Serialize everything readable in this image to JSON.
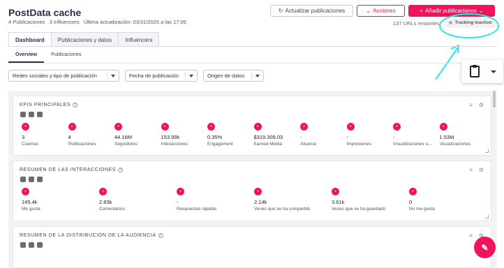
{
  "header": {
    "title": "PostData cache",
    "publications_count": "4 Publicaciones",
    "influencers_count": "3 Influencers",
    "last_update": "Última actualización: 03/31/2025 a las 17:05",
    "update_button": "Actualizar publicaciones",
    "actions_button": "Acciones",
    "add_button": "Añadir publicaciones",
    "urls_remaining": "137 URLs restantes",
    "tracking_status": "Tracking inactivo"
  },
  "tabs": [
    "Dashboard",
    "Publicaciones y datos",
    "Influencers"
  ],
  "subtabs": [
    "Overview",
    "Publicaciones"
  ],
  "filters": [
    "Redes sociales y tipo de publicación",
    "Fecha de publicación",
    "Origen de datos"
  ],
  "kpis_section": {
    "title": "KPIS PRINCIPALES",
    "items": [
      {
        "value": "3",
        "label": "Cuentas",
        "icon": "user-icon"
      },
      {
        "value": "4",
        "label": "Publicaciones",
        "icon": "post-icon"
      },
      {
        "value": "44.16M",
        "label": "Seguidores",
        "icon": "followers-icon"
      },
      {
        "value": "153.99k",
        "label": "Interacciones",
        "icon": "interaction-icon"
      },
      {
        "value": "0.35%",
        "label": "Engagement",
        "icon": "target-icon"
      },
      {
        "value": "$319.309.03",
        "label": "Earned Media",
        "icon": "dollar-icon"
      },
      {
        "value": "-",
        "label": "Alcance",
        "icon": "reach-icon"
      },
      {
        "value": "-",
        "label": "Impresiones",
        "icon": "eye-icon"
      },
      {
        "value": "-",
        "label": "Visualizaciones ú...",
        "icon": "play-icon"
      },
      {
        "value": "1.53M",
        "label": "Visualizaciones",
        "icon": "play-icon"
      }
    ]
  },
  "interactions_section": {
    "title": "RESUMEN DE LAS INTERACCIONES",
    "items": [
      {
        "value": "145.4k",
        "label": "Me gusta",
        "icon": "heart-icon"
      },
      {
        "value": "2.83k",
        "label": "Comentarios",
        "icon": "comment-icon"
      },
      {
        "value": "-",
        "label": "Respuestas rápidas",
        "icon": "quick-reply-icon"
      },
      {
        "value": "2.14k",
        "label": "Veces que se ha compartido",
        "icon": "share-icon"
      },
      {
        "value": "3.61k",
        "label": "Veces que se ha guardado",
        "icon": "bookmark-icon"
      },
      {
        "value": "0",
        "label": "No me gusta",
        "icon": "dislike-icon"
      }
    ]
  },
  "audience_section": {
    "title": "RESUMEN DE LA DISTRIBUCIÓN DE LA AUDIENCIA"
  },
  "colors": {
    "accent": "#f0145d",
    "annotation": "#2ee6e6"
  }
}
